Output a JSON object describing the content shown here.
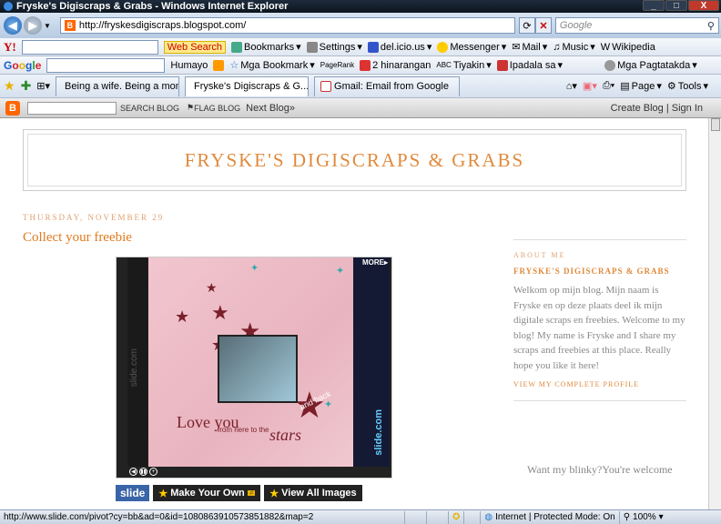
{
  "window": {
    "title": "Fryske's Digiscraps & Grabs - Windows Internet Explorer",
    "min": "_",
    "max": "□",
    "close": "X"
  },
  "address": {
    "url": "http://fryskesdigiscraps.blogspot.com/",
    "search_placeholder": "Google"
  },
  "toolbar1": {
    "yahoo": "Y!",
    "web_search": "Web Search",
    "bookmarks": "Bookmarks",
    "settings": "Settings",
    "delicious": "del.icio.us",
    "messenger": "Messenger",
    "mail": "Mail",
    "music": "Music",
    "wikipedia": "Wikipedia"
  },
  "toolbar2": {
    "google": [
      "G",
      "o",
      "o",
      "g",
      "l",
      "e"
    ],
    "humayo": "Humayo",
    "mga_bookmark": "Mga Bookmark",
    "pagerank": "PageRank",
    "hinarangan": "2 hinarangan",
    "tiyakin": "Tiyakin",
    "ipadala": "Ipadala sa",
    "pagtatakda": "Mga Pagtatakda"
  },
  "tabs": [
    {
      "label": "Being a wife. Being a mom..."
    },
    {
      "label": "Fryske's Digiscraps & G..."
    },
    {
      "label": "Gmail: Email from Google"
    }
  ],
  "cmdbar": {
    "page": "Page",
    "tools": "Tools"
  },
  "blogger_bar": {
    "search_blog": "SEARCH BLOG",
    "flag_blog": "FLAG BLOG",
    "next_blog": "Next Blog»",
    "create_blog": "Create Blog",
    "sign_in": "Sign In"
  },
  "blog": {
    "title": "FRYSKE'S DIGISCRAPS & GRABS",
    "post_date": "THURSDAY, NOVEMBER 29",
    "post_title": "Collect your freebie",
    "widget": {
      "more": "MORE",
      "love_you": "Love you",
      "from_here": "from here to the",
      "stars": "stars",
      "and_back": "and back",
      "slide_vertical": "slide.com",
      "slide_logo": "slide.com"
    },
    "slide_buttons": {
      "slide": "slide",
      "make_your_own": "Make Your Own",
      "view_all": "View All Images"
    }
  },
  "sidebar": {
    "about_heading": "ABOUT ME",
    "name": "FRYSKE'S DIGISCRAPS & GRABS",
    "bio": "Welkom op mijn blog. Mijn naam is Fryske en op deze plaats deel ik mijn digitale scraps en freebies. Welcome to my blog! My name is Fryske and I share my scraps and freebies at this place. Really hope you like it here!",
    "profile_link": "VIEW MY COMPLETE PROFILE",
    "blinky": "Want my blinky?You're welcome"
  },
  "status": {
    "url": "http://www.slide.com/pivot?cy=bb&ad=0&id=1080863910573851882&map=2",
    "zone": "Internet | Protected Mode: On",
    "zoom": "100%"
  }
}
